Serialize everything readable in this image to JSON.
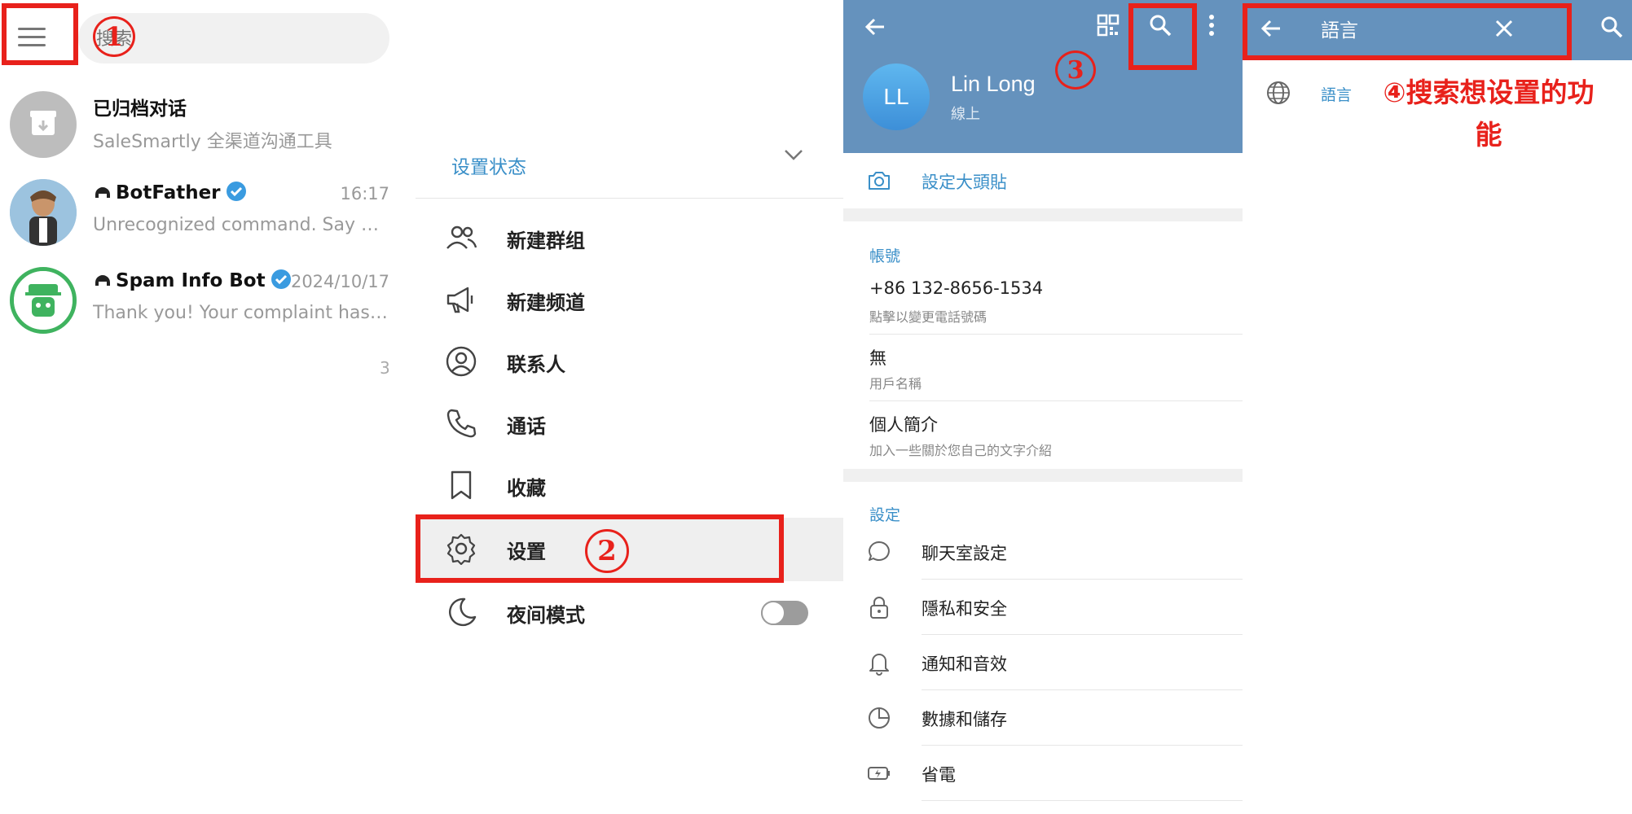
{
  "panel1": {
    "search_placeholder": "搜索",
    "marker": "1",
    "chats": [
      {
        "name": "已归档对话",
        "preview": "SaleSmartly 全渠道沟通工具",
        "time": ""
      },
      {
        "name": "BotFather",
        "preview": "Unrecognized command. Say wh...",
        "time": "16:17"
      },
      {
        "name": "Spam Info Bot",
        "preview": "Thank you! Your complaint has b...",
        "time": "2024/10/17"
      }
    ],
    "partial_time": "3"
  },
  "panel2": {
    "set_status": "设置状态",
    "marker": "2",
    "menu": [
      {
        "label": "新建群组",
        "icon": "group-icon"
      },
      {
        "label": "新建频道",
        "icon": "megaphone-icon"
      },
      {
        "label": "联系人",
        "icon": "contact-icon"
      },
      {
        "label": "通话",
        "icon": "phone-icon"
      },
      {
        "label": "收藏",
        "icon": "bookmark-icon"
      },
      {
        "label": "设置",
        "icon": "gear-icon"
      },
      {
        "label": "夜间模式",
        "icon": "moon-icon"
      }
    ]
  },
  "panel3": {
    "marker": "3",
    "avatar_initials": "LL",
    "name": "Lin Long",
    "status": "線上",
    "set_photo": "設定大頭貼",
    "account_title": "帳號",
    "phone": "+86 132-8656-1534",
    "phone_hint": "點擊以變更電話號碼",
    "username": "無",
    "username_hint": "用戶名稱",
    "bio": "個人簡介",
    "bio_hint": "加入一些關於您自己的文字介紹",
    "settings_title": "設定",
    "settings": [
      {
        "label": "聊天室設定",
        "icon": "chat-bubble-icon"
      },
      {
        "label": "隱私和安全",
        "icon": "lock-icon"
      },
      {
        "label": "通知和音效",
        "icon": "bell-icon"
      },
      {
        "label": "數據和儲存",
        "icon": "pie-chart-icon"
      },
      {
        "label": "省電",
        "icon": "battery-icon"
      }
    ]
  },
  "panel4": {
    "query": "語言",
    "result": "語言",
    "marker": "④",
    "annotation": "搜索想设置的功能"
  },
  "colors": {
    "accent": "#3a8fc8",
    "header_blue": "#6592bd",
    "annotation_red": "#e8211b"
  }
}
